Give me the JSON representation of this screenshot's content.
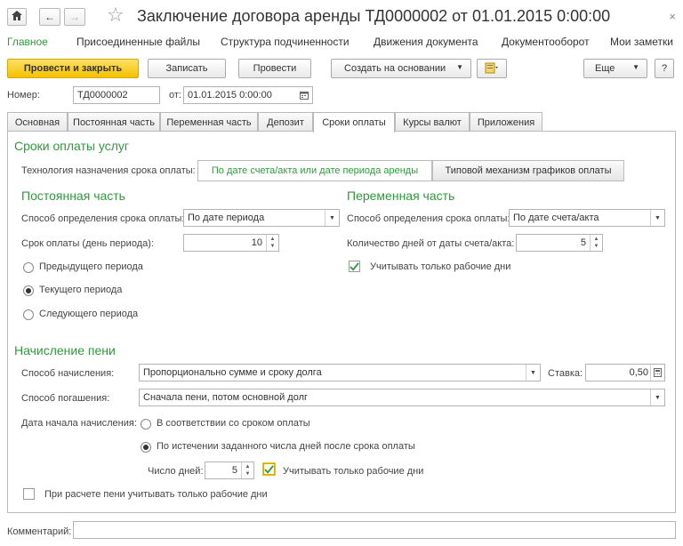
{
  "window": {
    "title": "Заключение договора аренды ТД0000002 от 01.01.2015 0:00:00",
    "close_icon": "×"
  },
  "nav": {
    "home_icon": "home-icon",
    "back": "←",
    "forward": "→",
    "star": "☆",
    "links": [
      "Главное",
      "Присоединенные файлы",
      "Структура подчиненности",
      "Движения документа",
      "Документооборот",
      "Мои заметки"
    ]
  },
  "toolbar": {
    "post_close": "Провести и закрыть",
    "save": "Записать",
    "post": "Провести",
    "create_based": "Создать на основании",
    "more": "Еще",
    "help": "?"
  },
  "header": {
    "number_label": "Номер:",
    "number_value": "ТД0000002",
    "date_label": "от:",
    "date_value": "01.01.2015  0:00:00"
  },
  "tabs": [
    "Основная",
    "Постоянная часть",
    "Переменная часть",
    "Депозит",
    "Сроки оплаты",
    "Курсы валют",
    "Приложения"
  ],
  "active_tab": "Сроки оплаты",
  "payment": {
    "section_title": "Сроки оплаты услуг",
    "tech_label": "Технология назначения срока оплаты:",
    "tech_option_1": "По дате счета/акта или дате периода аренды",
    "tech_option_2": "Типовой механизм графиков оплаты"
  },
  "fixed": {
    "title": "Постоянная часть",
    "method_label": "Способ определения срока оплаты:",
    "method_value": "По дате периода",
    "term_label": "Срок оплаты (день периода):",
    "term_value": "10",
    "radio_prev": "Предыдущего периода",
    "radio_current": "Текущего периода",
    "radio_next": "Следующего периода",
    "selected": "Текущего периода"
  },
  "variable": {
    "title": "Переменная часть",
    "method_label": "Способ определения срока оплаты:",
    "method_value": "По дате счета/акта",
    "days_label": "Количество дней от даты счета/акта:",
    "days_value": "5",
    "workdays_label": "Учитывать только рабочие дни",
    "workdays_checked": true
  },
  "penalty": {
    "title": "Начисление пени",
    "accrual_label": "Способ начисления:",
    "accrual_value": "Пропорционально сумме и сроку долга",
    "rate_label": "Ставка:",
    "rate_value": "0,50",
    "repay_label": "Способ погашения:",
    "repay_value": "Сначала пени, потом основной долг",
    "start_label": "Дата начала начисления:",
    "start_opt_1": "В соответствии со сроком оплаты",
    "start_opt_2": "По истечении заданного числа дней после срока оплаты",
    "days_label": "Число дней:",
    "days_value": "5",
    "days_workdays_label": "Учитывать только рабочие дни",
    "days_workdays_checked": true,
    "calc_workdays_label": "При расчете пени учитывать только рабочие дни",
    "calc_workdays_checked": false
  },
  "comment": {
    "label": "Комментарий:",
    "value": ""
  },
  "colors": {
    "accent_green": "#2f9a3c",
    "primary_button": "#f2c200"
  }
}
